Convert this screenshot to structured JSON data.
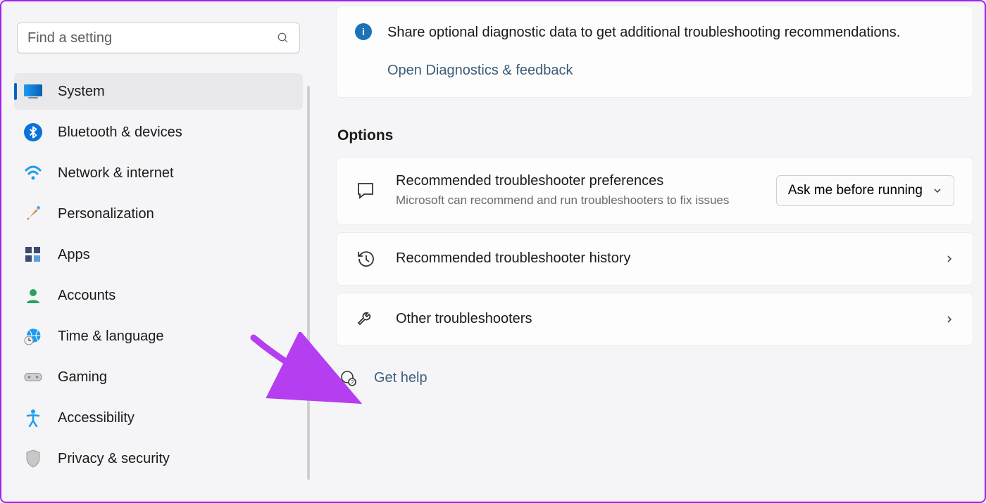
{
  "search": {
    "placeholder": "Find a setting"
  },
  "sidebar": {
    "items": [
      {
        "label": "System",
        "icon": "system",
        "active": true
      },
      {
        "label": "Bluetooth & devices",
        "icon": "bluetooth",
        "active": false
      },
      {
        "label": "Network & internet",
        "icon": "wifi",
        "active": false
      },
      {
        "label": "Personalization",
        "icon": "brush",
        "active": false
      },
      {
        "label": "Apps",
        "icon": "apps",
        "active": false
      },
      {
        "label": "Accounts",
        "icon": "account",
        "active": false
      },
      {
        "label": "Time & language",
        "icon": "clock-globe",
        "active": false
      },
      {
        "label": "Gaming",
        "icon": "gamepad",
        "active": false
      },
      {
        "label": "Accessibility",
        "icon": "accessibility",
        "active": false
      },
      {
        "label": "Privacy & security",
        "icon": "shield",
        "active": false
      }
    ]
  },
  "info_card": {
    "text": "Share optional diagnostic data to get additional troubleshooting recommendations.",
    "link_label": "Open Diagnostics & feedback"
  },
  "options": {
    "heading": "Options",
    "pref": {
      "title": "Recommended troubleshooter preferences",
      "subtitle": "Microsoft can recommend and run troubleshooters to fix issues",
      "selected": "Ask me before running"
    },
    "history": {
      "title": "Recommended troubleshooter history"
    },
    "other": {
      "title": "Other troubleshooters"
    }
  },
  "help": {
    "label": "Get help"
  },
  "colors": {
    "accent": "#0067c0",
    "info_icon": "#1c73b7",
    "annotation_arrow": "#b43ef0"
  }
}
